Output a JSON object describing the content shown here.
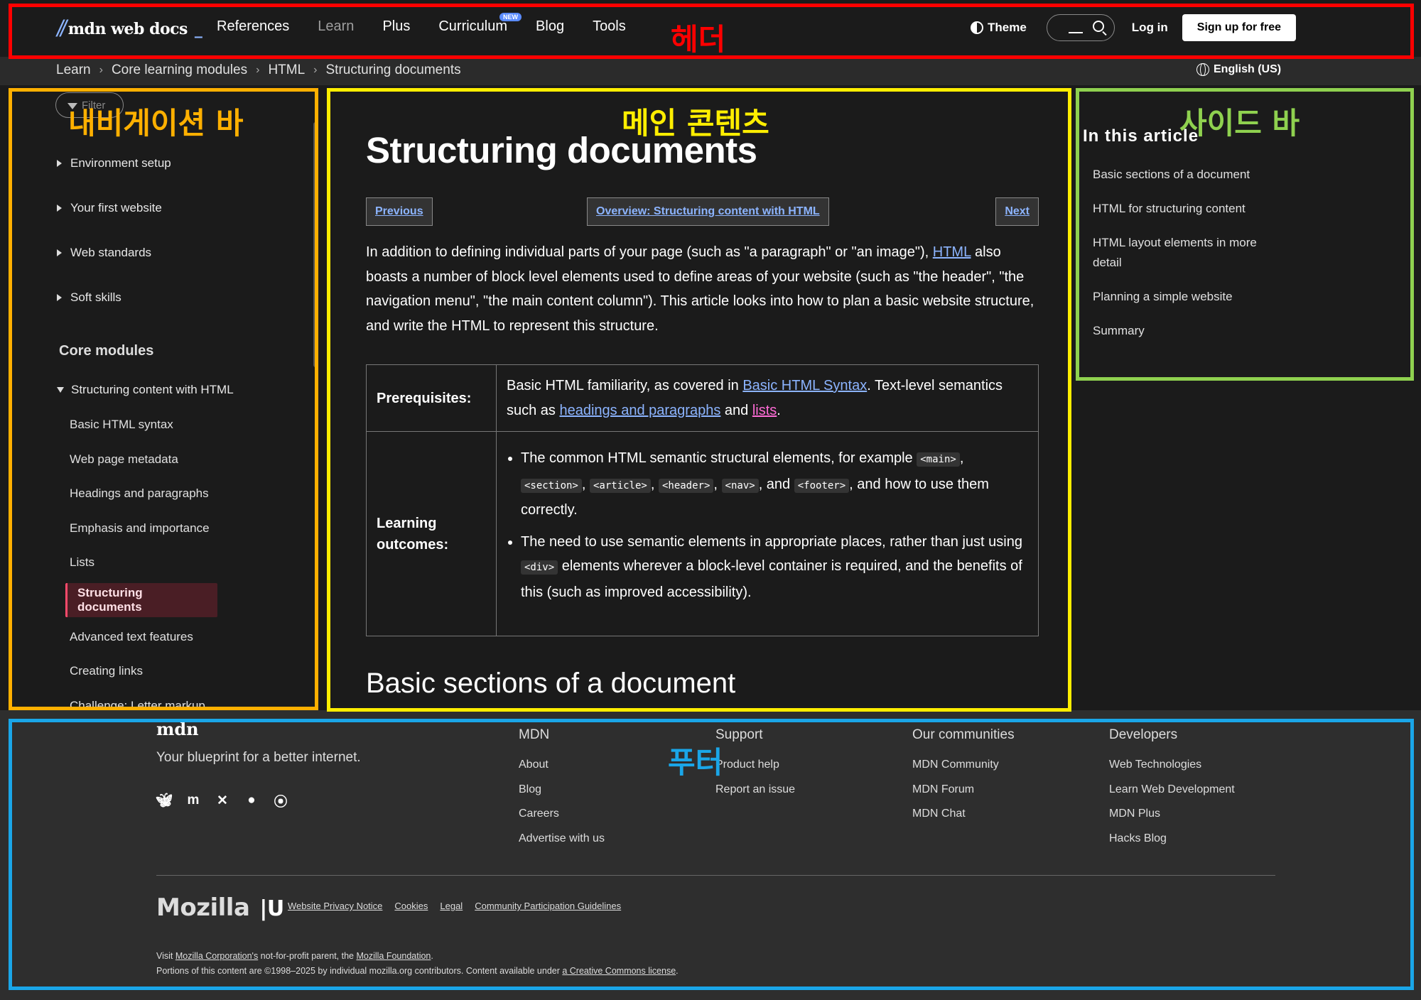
{
  "header": {
    "logo_text": "mdn web docs",
    "nav": [
      {
        "label": "References",
        "dim": false
      },
      {
        "label": "Learn",
        "dim": true
      },
      {
        "label": "Plus",
        "dim": false
      },
      {
        "label": "Curriculum",
        "dim": false,
        "badge": "NEW"
      },
      {
        "label": "Blog",
        "dim": false
      },
      {
        "label": "Tools",
        "dim": false
      }
    ],
    "theme_label": "Theme",
    "login_label": "Log in",
    "signup_label": "Sign up for free"
  },
  "breadcrumb": [
    "Learn",
    "Core learning modules",
    "HTML",
    "Structuring documents"
  ],
  "language_label": "English (US)",
  "sidebar": {
    "filter_placeholder": "Filter",
    "top_items": [
      "Environment setup",
      "Your first website",
      "Web standards",
      "Soft skills"
    ],
    "section_title": "Core modules",
    "open_group": "Structuring content with HTML",
    "sub_items": [
      {
        "label": "Basic HTML syntax",
        "active": false
      },
      {
        "label": "Web page metadata",
        "active": false
      },
      {
        "label": "Headings and paragraphs",
        "active": false
      },
      {
        "label": "Emphasis and importance",
        "active": false
      },
      {
        "label": "Lists",
        "active": false
      },
      {
        "label": "Structuring documents",
        "active": true
      },
      {
        "label": "Advanced text features",
        "active": false
      },
      {
        "label": "Creating links",
        "active": false
      },
      {
        "label": "Challenge: Letter markup",
        "active": false
      }
    ]
  },
  "main": {
    "title": "Structuring documents",
    "pager": {
      "previous": "Previous",
      "overview": "Overview: Structuring content with HTML",
      "next": "Next"
    },
    "intro": {
      "before": "In addition to defining individual parts of your page (such as \"a paragraph\" or \"an image\"), ",
      "link": "HTML",
      "after": " also boasts a number of block level elements used to define areas of your website (such as \"the header\", \"the navigation menu\", \"the main content column\"). This article looks into how to plan a basic website structure, and write the HTML to represent this structure."
    },
    "prerequisites": {
      "label": "Prerequisites:",
      "t1": "Basic HTML familiarity, as covered in ",
      "link1": "Basic HTML Syntax",
      "t2": ". Text-level semantics such as ",
      "link2": "headings and paragraphs",
      "t3": " and ",
      "link3": "lists",
      "t4": "."
    },
    "outcomes": {
      "label": "Learning outcomes:",
      "item1_before": "The common HTML semantic structural elements, for example ",
      "codes": [
        "<main>",
        "<section>",
        "<article>",
        "<header>",
        "<nav>",
        "<footer>"
      ],
      "item1_and": ", and ",
      "item1_after": ", and how to use them correctly.",
      "item2_before": "The need to use semantic elements in appropriate places, rather than just using ",
      "item2_code": "<div>",
      "item2_after": " elements wherever a block-level container is required, and the benefits of this (such as improved accessibility)."
    },
    "section_heading": "Basic sections of a document"
  },
  "toc": {
    "title": "In this article",
    "items": [
      "Basic sections of a document",
      "HTML for structuring content",
      "HTML layout elements in more detail",
      "Planning a simple website",
      "Summary"
    ]
  },
  "footer": {
    "logo": "mdn",
    "tagline": "Your blueprint for a better internet.",
    "socials": [
      "bluesky-icon",
      "mastodon-icon",
      "x-icon",
      "github-icon",
      "rss-icon"
    ],
    "columns": [
      {
        "title": "MDN",
        "links": [
          "About",
          "Blog",
          "Careers",
          "Advertise with us"
        ]
      },
      {
        "title": "Support",
        "links": [
          "Product help",
          "Report an issue"
        ]
      },
      {
        "title": "Our communities",
        "links": [
          "MDN Community",
          "MDN Forum",
          "MDN Chat"
        ]
      },
      {
        "title": "Developers",
        "links": [
          "Web Technologies",
          "Learn Web Development",
          "MDN Plus",
          "Hacks Blog"
        ]
      }
    ],
    "mozilla_logo": "Mozilla",
    "legal_links": [
      "Website Privacy Notice",
      "Cookies",
      "Legal",
      "Community Participation Guidelines"
    ],
    "fine1": {
      "t1": "Visit ",
      "l1": "Mozilla Corporation's",
      "t2": " not-for-profit parent, the ",
      "l2": "Mozilla Foundation",
      "t3": "."
    },
    "fine2": {
      "t1": "Portions of this content are ©1998–2025 by individual mozilla.org contributors. Content available under ",
      "l1": "a Creative Commons license",
      "t2": "."
    }
  },
  "annotations": [
    {
      "label": "헤더",
      "color": "#ff0000"
    },
    {
      "label": "내비게이션 바",
      "color": "#ffb000"
    },
    {
      "label": "메인 콘텐츠",
      "color": "#ffee00"
    },
    {
      "label": "사이드 바",
      "color": "#8fd14f"
    },
    {
      "label": "푸터",
      "color": "#1aa6e8"
    }
  ]
}
